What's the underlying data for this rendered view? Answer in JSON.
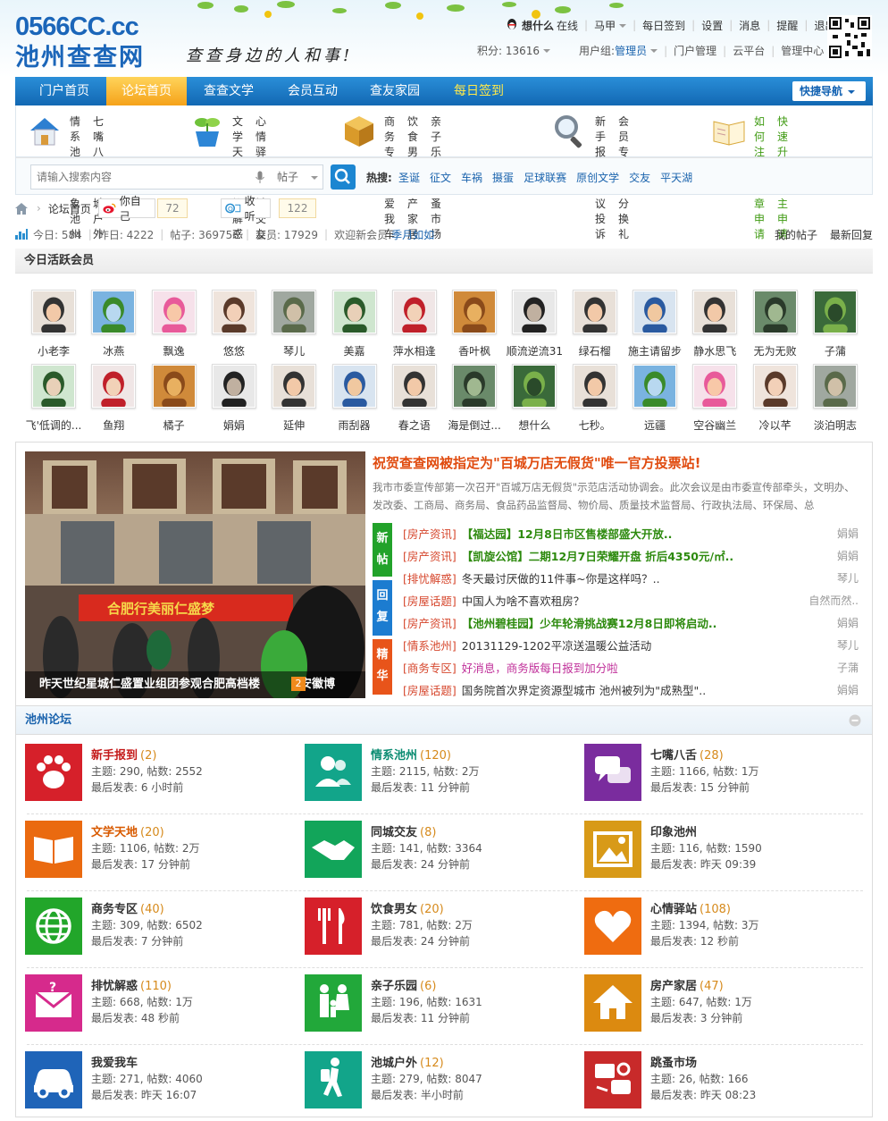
{
  "site": {
    "logo_number": "0566CC.cc",
    "logo_name": "池州查查网",
    "slogan": "查查身边的人和事!"
  },
  "user": {
    "name": "想什么",
    "status": "在线",
    "links_row1": [
      "马甲",
      "每日签到",
      "设置",
      "消息",
      "提醒",
      "退出"
    ],
    "points_label": "积分: 13616",
    "group_label": "用户组: ",
    "group_value": "管理员",
    "links_row2": [
      "门户管理",
      "云平台",
      "管理中心"
    ]
  },
  "nav": {
    "items": [
      "门户首页",
      "论坛首页",
      "查查文学",
      "会员互动",
      "查友家园",
      "每日签到"
    ],
    "active": "论坛首页",
    "quick": "快捷导航"
  },
  "subnav": [
    {
      "links": [
        "情系池州",
        "七嘴八舌",
        "印象池州",
        "池城户外"
      ]
    },
    {
      "links": [
        "文学天地",
        "心情驿站",
        "排忧解惑",
        "同城交友"
      ]
    },
    {
      "links": [
        "商务专区",
        "饮食男女",
        "亲子乐园",
        "我爱我车",
        "房产家居",
        "跳蚤市场"
      ]
    },
    {
      "links": [
        "新手报到",
        "会员专区",
        "建议投诉",
        "积分换礼"
      ]
    },
    {
      "links": [
        "如何注册",
        "快速升级",
        "勋章申请",
        "版主申请"
      ]
    }
  ],
  "search": {
    "placeholder": "请输入搜索内容",
    "type": "帖子",
    "hot_label": "热搜:",
    "hot": [
      "圣诞",
      "征文",
      "车祸",
      "摄蛋",
      "足球联赛",
      "原创文学",
      "交友",
      "平天湖"
    ]
  },
  "breadcrumb": {
    "home": "论坛首页"
  },
  "share": {
    "weibo_label": "你自己",
    "weibo_count": "72",
    "listen_label": "收听",
    "listen_count": "122"
  },
  "stats": {
    "today": "今日: 584",
    "yesterday": "昨日: 4222",
    "posts": "帖子: 369756",
    "members": "会员: 17929",
    "welcome": "欢迎新会员: ",
    "newbie": "季月如如",
    "my_posts": "我的帖子",
    "latest": "最新回复"
  },
  "active_members": {
    "title": "今日活跃会员",
    "row1": [
      "小老李",
      "冰燕",
      "飘逸",
      "悠悠",
      "琴儿",
      "美嘉",
      "萍水相逢",
      "香叶枫",
      "顺流逆流31",
      "绿石榴",
      "施主请留步",
      "静水思飞",
      "无为无败",
      "子蒲"
    ],
    "row2": [
      "飞'低调的...",
      "鱼翔",
      "橘子",
      "娟娟",
      "延伸",
      "雨刮器",
      "春之语",
      "海是倒过...",
      "想什么",
      "七秒。",
      "远疆",
      "空谷幽兰",
      "冷以芊",
      "淡泊明志"
    ]
  },
  "feature": {
    "slide_caption": "昨天世纪星城仁盛置业组团参观合肥高档楼",
    "slide_caption_tail": "1安徽博",
    "slide_num": "2",
    "banner_text": "合肥行美丽仁盛梦",
    "headline": "祝贺查查网被指定为\"百城万店无假货\"唯一官方投票站!",
    "summary": "我市市委宣传部第一次召开\"百城万店无假货\"示范店活动协调会。此次会议是由市委宣传部牵头，文明办、发改委、工商局、商务局、食品药品监督局、物价局、质量技术监督局、行政执法局、环保局、总",
    "tabs": [
      "新帖",
      "回复",
      "精华"
    ],
    "posts": [
      {
        "cat": "[房产资讯]",
        "title": "【福达园】12月8日市区售楼部盛大开放..",
        "author": "娟娟",
        "color": "#2d8a0e",
        "bold": true
      },
      {
        "cat": "[房产资讯]",
        "title": "【凯旋公馆】二期12月7日荣耀开盘 折后4350元/㎡..",
        "author": "娟娟",
        "color": "#2d8a0e",
        "bold": true
      },
      {
        "cat": "[排忧解惑]",
        "title": "冬天最讨厌做的11件事~你是这样吗？..",
        "author": "琴儿",
        "color": "#333333",
        "bold": false
      },
      {
        "cat": "[房屋话题]",
        "title": "中国人为啥不喜欢租房？",
        "author": "自然而然..",
        "color": "#333333",
        "bold": false
      },
      {
        "cat": "[房产资讯]",
        "title": "【池州碧桂园】少年轮滑挑战赛12月8日即将启动..",
        "author": "娟娟",
        "color": "#2d8a0e",
        "bold": true
      },
      {
        "cat": "[情系池州]",
        "title": "20131129-1202平凉送温暖公益活动",
        "author": "琴儿",
        "color": "#333333",
        "bold": false
      },
      {
        "cat": "[商务专区]",
        "title": "好消息，商务版每日报到加分啦",
        "author": "子蒲",
        "color": "#c0309a",
        "bold": false
      },
      {
        "cat": "[房屋话题]",
        "title": "国务院首次界定资源型城市 池州被列为\"成熟型\"..",
        "author": "娟娟",
        "color": "#333333",
        "bold": false
      }
    ]
  },
  "forum": {
    "title": "池州论坛",
    "boards": [
      {
        "name": "新手报到",
        "count": "(2)",
        "stat": "主题: 290, 帖数: 2552",
        "last": "最后发表: 6 小时前",
        "color": "#d6202a",
        "name_color": "#c41a1a",
        "icon": "paw-icon"
      },
      {
        "name": "情系池州",
        "count": "(120)",
        "stat": "主题: 2115, 帖数: 2万",
        "last": "最后发表: 11 分钟前",
        "color": "#12a58a",
        "name_color": "#0b8c72",
        "icon": "people-icon"
      },
      {
        "name": "七嘴八舌",
        "count": "(28)",
        "stat": "主题: 1166, 帖数: 1万",
        "last": "最后发表: 15 分钟前",
        "color": "#7a2c9e",
        "name_color": "#333333",
        "icon": "chat-bubbles-icon"
      },
      {
        "name": "文学天地",
        "count": "(20)",
        "stat": "主题: 1106, 帖数: 2万",
        "last": "最后发表: 17 分钟前",
        "color": "#ea6a10",
        "name_color": "#d85a00",
        "icon": "book-icon"
      },
      {
        "name": "同城交友",
        "count": "(8)",
        "stat": "主题: 141, 帖数: 3364",
        "last": "最后发表: 24 分钟前",
        "color": "#12a55a",
        "name_color": "#333333",
        "icon": "handshake-icon"
      },
      {
        "name": "印象池州",
        "count": "",
        "stat": "主题: 116, 帖数: 1590",
        "last": "最后发表: 昨天 09:39",
        "color": "#d89a18",
        "name_color": "#333333",
        "icon": "picture-icon"
      },
      {
        "name": "商务专区",
        "count": "(40)",
        "stat": "主题: 309, 帖数: 6502",
        "last": "最后发表: 7 分钟前",
        "color": "#22a62a",
        "name_color": "#333333",
        "icon": "globe-icon"
      },
      {
        "name": "饮食男女",
        "count": "(20)",
        "stat": "主题: 781, 帖数: 2万",
        "last": "最后发表: 24 分钟前",
        "color": "#d6202a",
        "name_color": "#333333",
        "icon": "fork-knife-icon"
      },
      {
        "name": "心情驿站",
        "count": "(108)",
        "stat": "主题: 1394, 帖数: 3万",
        "last": "最后发表: 12 秒前",
        "color": "#ef6c10",
        "name_color": "#333333",
        "icon": "heart-icon"
      },
      {
        "name": "排忧解惑",
        "count": "(110)",
        "stat": "主题: 668, 帖数: 1万",
        "last": "最后发表: 48 秒前",
        "color": "#d62a8c",
        "name_color": "#333333",
        "icon": "question-mail-icon"
      },
      {
        "name": "亲子乐园",
        "count": "(6)",
        "stat": "主题: 196, 帖数: 1631",
        "last": "最后发表: 11 分钟前",
        "color": "#22a83a",
        "name_color": "#333333",
        "icon": "family-icon"
      },
      {
        "name": "房产家居",
        "count": "(47)",
        "stat": "主题: 647, 帖数: 1万",
        "last": "最后发表: 3 分钟前",
        "color": "#dc8a10",
        "name_color": "#333333",
        "icon": "house-icon"
      },
      {
        "name": "我爱我车",
        "count": "",
        "stat": "主题: 271, 帖数: 4060",
        "last": "最后发表: 昨天 16:07",
        "color": "#1f64b8",
        "name_color": "#333333",
        "icon": "car-icon"
      },
      {
        "name": "池城户外",
        "count": "(12)",
        "stat": "主题: 279, 帖数: 8047",
        "last": "最后发表: 半小时前",
        "color": "#12a58a",
        "name_color": "#333333",
        "icon": "hiker-icon"
      },
      {
        "name": "跳蚤市场",
        "count": "",
        "stat": "主题: 26, 帖数: 166",
        "last": "最后发表: 昨天 08:23",
        "color": "#c82a2a",
        "name_color": "#333333",
        "icon": "market-icon"
      }
    ]
  },
  "colors": {
    "brand_blue": "#1b66b9",
    "nav_active": "#f5a21a",
    "headline": "#e04b0f",
    "tab_new": "#22a22a",
    "tab_reply": "#1c7cd0",
    "tab_digest": "#e8541a"
  }
}
